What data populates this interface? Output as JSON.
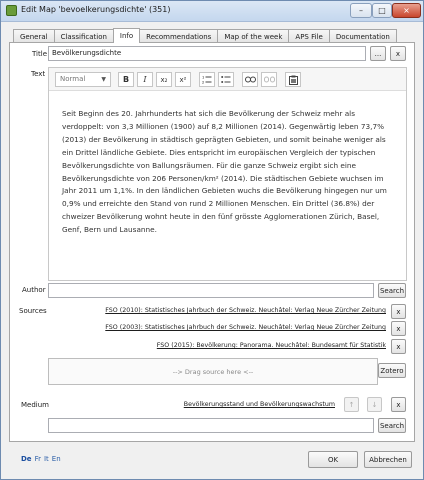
{
  "window": {
    "title": "Edit Map 'bevoelkerungsdichte' (351)",
    "minimize_glyph": "–",
    "maximize_glyph": "□",
    "close_glyph": "×"
  },
  "tabs": [
    {
      "label": "General"
    },
    {
      "label": "Classification"
    },
    {
      "label": "Info"
    },
    {
      "label": "Recommendations"
    },
    {
      "label": "Map of the week"
    },
    {
      "label": "APS File"
    },
    {
      "label": "Documentation"
    }
  ],
  "active_tab": "Info",
  "title_field": {
    "label": "Title",
    "value": "Bevölkerungsdichte",
    "more_button": "...",
    "clear_button": "x"
  },
  "text_field": {
    "label": "Text",
    "format_select": "Normal",
    "toolbar_icons": [
      "bold-icon",
      "italic-icon",
      "subscript-icon",
      "superscript-icon",
      "ordered-list-icon",
      "unordered-list-icon",
      "link-icon",
      "unlink-icon",
      "paste-icon"
    ],
    "bold_glyph": "B",
    "italic_glyph": "I",
    "subscript_glyph": "x₂",
    "superscript_glyph": "x²",
    "body": "Seit Beginn des 20. Jahrhunderts hat sich die Bevölkerung der Schweiz mehr als verdoppelt: von 3,3 Millionen (1900) auf 8,2 Millionen (2014). Gegenwärtig leben 73,7% (2013) der Bevölkerung in städtisch geprägten Gebieten, und somit beinahe weniger als ein Drittel ländliche Gebiete. Dies entspricht im europäischen Vergleich der typischen Bevölkerungsdichte von Ballungsräumen. Für die ganze Schweiz ergibt sich eine Bevölkerungsdichte von 206 Personen/km² (2014). Die städtischen Gebiete wuchsen im Jahr 2011 um 1,1%. In den ländlichen Gebieten wuchs die Bevölkerung hingegen nur um 0,9% und erreichte den Stand von rund 2 Millionen Menschen. Ein Drittel (36.8%) der chweizer Bevölkerung wohnt heute in den fünf grösste Agglomerationen Zürich, Basel, Genf, Bern und Lausanne."
  },
  "author": {
    "label": "Author",
    "value": "",
    "search_button": "Search"
  },
  "sources": {
    "label": "Sources",
    "items": [
      {
        "text": "FSO (2010): Statistisches Jahrbuch der Schweiz. Neuchâtel: Verlag Neue Zürcher Zeitung"
      },
      {
        "text": "FSO (2003): Statistisches Jahrbuch der Schweiz. Neuchâtel: Verlag Neue Zürcher Zeitung"
      },
      {
        "text": "FSO (2015): Bevölkerung: Panorama. Neuchâtel: Bundesamt für Statistik"
      }
    ],
    "remove_button": "x",
    "dropzone": "--> Drag source here <--",
    "refresh_glyph": "↻",
    "zotero_button": "Zotero"
  },
  "medium": {
    "label": "Medium",
    "link": "Bevölkerungsstand und Bevölkerungswachstum",
    "up_glyph": "↑",
    "down_glyph": "↓",
    "remove_button": "x",
    "value": "",
    "search_button": "Search"
  },
  "languages": [
    {
      "code": "De",
      "current": true
    },
    {
      "code": "Fr",
      "current": false
    },
    {
      "code": "It",
      "current": false
    },
    {
      "code": "En",
      "current": false
    }
  ],
  "footer": {
    "ok_button": "OK",
    "cancel_button": "Abbrechen"
  }
}
